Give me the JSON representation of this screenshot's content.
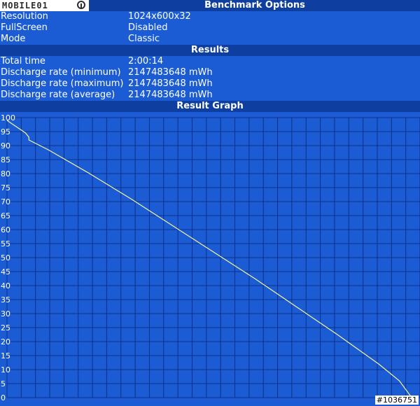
{
  "logo": {
    "text": "MOBILE01"
  },
  "sections": {
    "options_title": "Benchmark Options",
    "results_title": "Results",
    "graph_title": "Result Graph"
  },
  "options": [
    {
      "label": "Resolution",
      "value": "1024x600x32"
    },
    {
      "label": "FullScreen",
      "value": "Disabled"
    },
    {
      "label": "Mode",
      "value": "Classic"
    }
  ],
  "results": [
    {
      "label": "Total time",
      "value": "2:00:14"
    },
    {
      "label": "Discharge rate (minimum)",
      "value": "2147483648 mWh"
    },
    {
      "label": "Discharge rate (maximum)",
      "value": "2147483648 mWh"
    },
    {
      "label": "Discharge rate (average)",
      "value": "2147483648 mWh"
    }
  ],
  "serial": "#1036751",
  "colors": {
    "background": "#1b5cd4",
    "header": "#0e3fa0",
    "grid": "#0c2f86",
    "line": "#f4f4a0"
  },
  "chart_data": {
    "type": "line",
    "title": "Result Graph",
    "xlabel": "",
    "ylabel": "",
    "ylim": [
      0,
      100
    ],
    "xlim": [
      0,
      1
    ],
    "grid": true,
    "legend": "none",
    "yticks": [
      "0",
      "5",
      "10",
      "15",
      "20",
      "25",
      "30",
      "35",
      "40",
      "45",
      "50",
      "55",
      "60",
      "65",
      "70",
      "75",
      "80",
      "85",
      "90",
      "95",
      "100"
    ],
    "series": [
      {
        "x": [
          0,
          0.045,
          0.053,
          0.053,
          0.1,
          0.2,
          0.3,
          0.4,
          0.5,
          0.6,
          0.7,
          0.8,
          0.9,
          0.95,
          0.98
        ],
        "y": [
          99,
          94.5,
          93,
          92,
          88.5,
          80,
          71,
          61.5,
          52,
          42.5,
          32.5,
          22.5,
          12,
          6,
          0
        ]
      }
    ]
  }
}
